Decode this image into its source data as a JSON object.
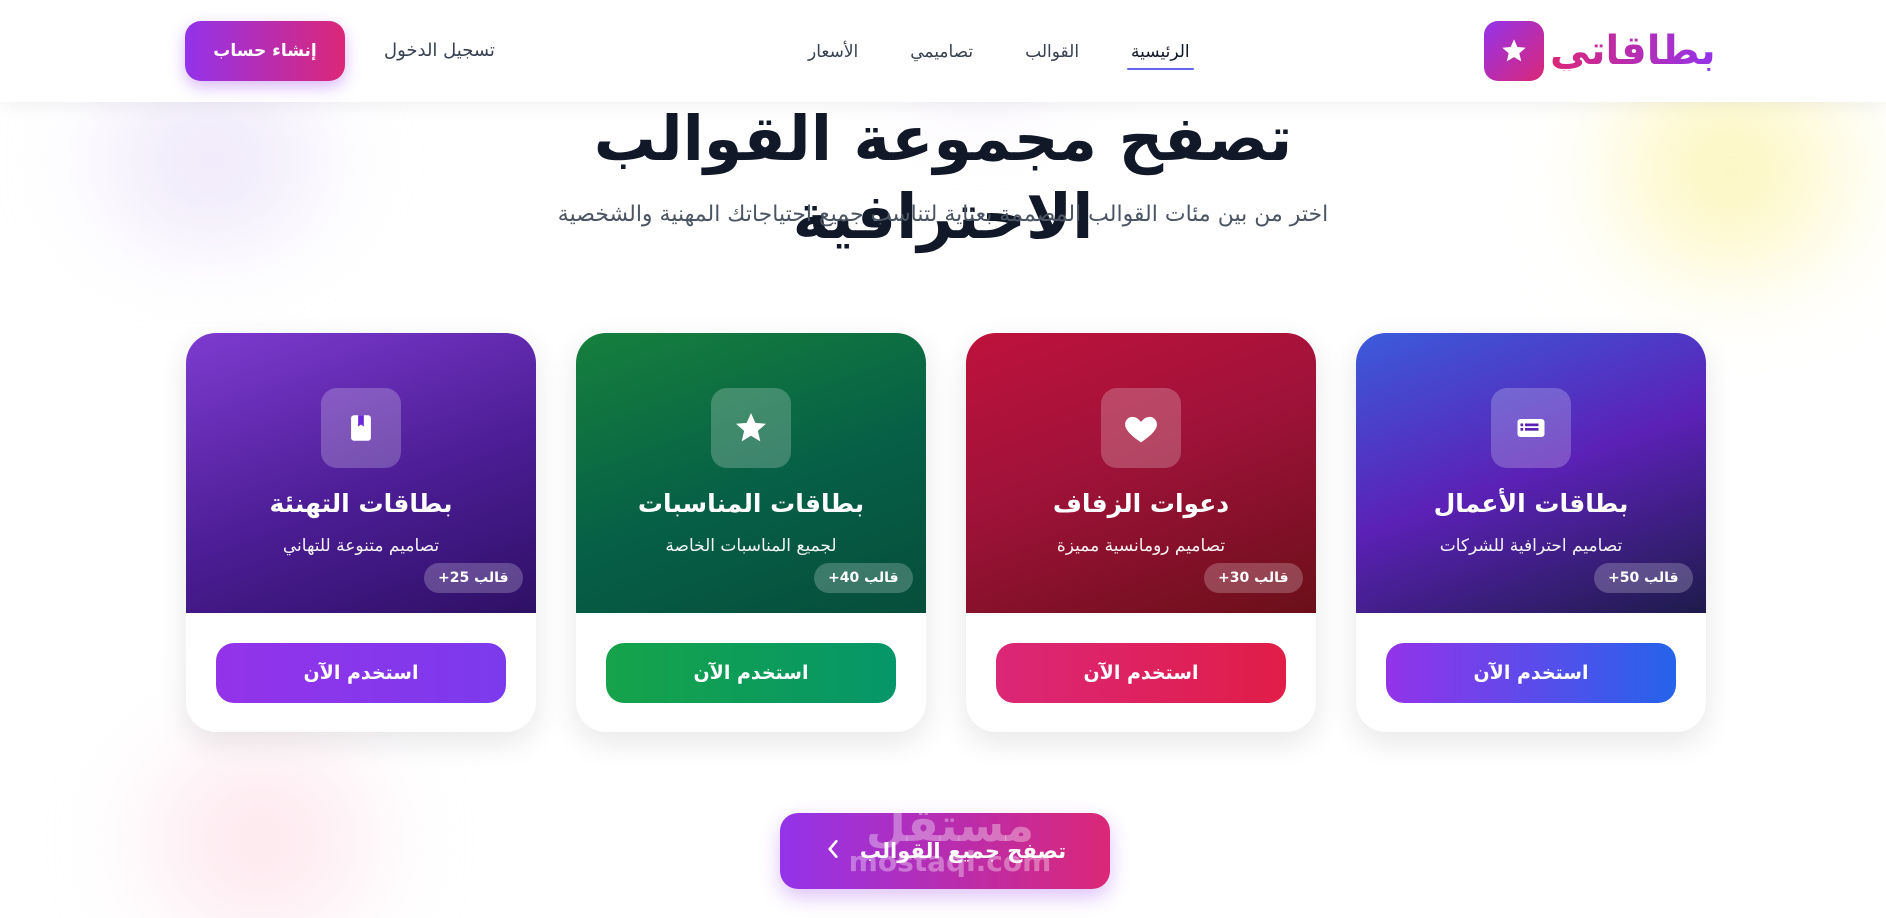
{
  "brand": {
    "name": "بطاقاتي",
    "logo_icon": "star-icon"
  },
  "nav": {
    "items": [
      {
        "label": "الرئيسية",
        "active": true
      },
      {
        "label": "القوالب",
        "active": false
      },
      {
        "label": "تصاميمي",
        "active": false
      },
      {
        "label": "الأسعار",
        "active": false
      }
    ]
  },
  "auth": {
    "login_label": "تسجيل الدخول",
    "signup_label": "إنشاء حساب"
  },
  "hero": {
    "title": "تصفح مجموعة القوالب الاحترافية",
    "subtitle": "اختر من بين مئات القوالب المصممة بعناية لتناسب جميع احتياجاتك المهنية والشخصية"
  },
  "cards": [
    {
      "title": "بطاقات الأعمال",
      "description": "تصاميم احترافية للشركات",
      "badge": "+50 قالب",
      "button": "استخدم الآن",
      "icon": "id-card-icon",
      "accent": "#4f46e5"
    },
    {
      "title": "دعوات الزفاف",
      "description": "تصاميم رومانسية مميزة",
      "badge": "+30 قالب",
      "button": "استخدم الآن",
      "icon": "heart-icon",
      "accent": "#be123c"
    },
    {
      "title": "بطاقات المناسبات",
      "description": "لجميع المناسبات الخاصة",
      "badge": "+40 قالب",
      "button": "استخدم الآن",
      "icon": "star-icon",
      "accent": "#15803d"
    },
    {
      "title": "بطاقات التهنئة",
      "description": "تصاميم متنوعة للتهاني",
      "badge": "+25 قالب",
      "button": "استخدم الآن",
      "icon": "book-icon",
      "accent": "#7e3bd0"
    }
  ],
  "browse_all": {
    "label": "تصفح جميع القوالب",
    "icon": "chevron-left-icon"
  },
  "watermark": {
    "arabic": "مستقل",
    "latin": "mostaql.com"
  }
}
